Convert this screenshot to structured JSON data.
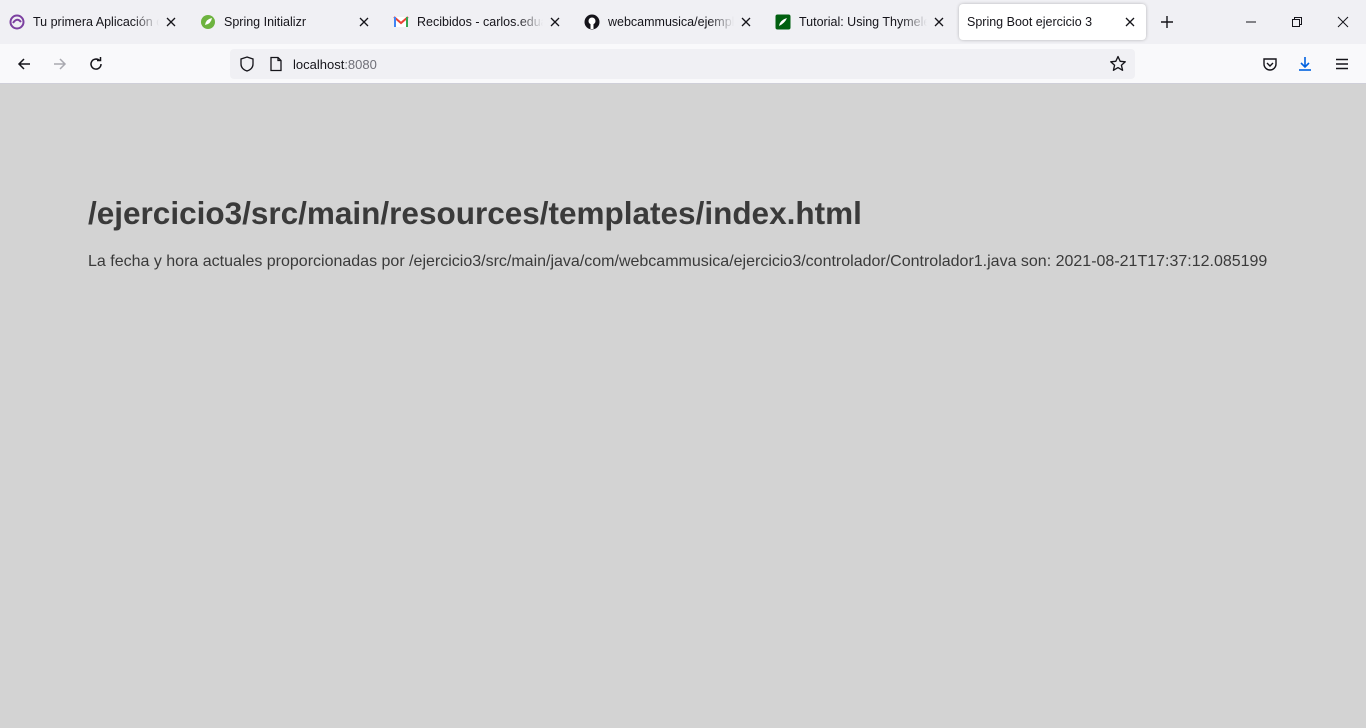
{
  "tabs": [
    {
      "title": "Tu primera Aplicación con",
      "favicon": "purple-swirl-icon",
      "active": false
    },
    {
      "title": "Spring Initializr",
      "favicon": "spring-leaf-icon",
      "active": false
    },
    {
      "title": "Recibidos - carlos.eduardo",
      "favicon": "gmail-icon",
      "active": false
    },
    {
      "title": "webcammusica/ejemplo-",
      "favicon": "github-icon",
      "active": false
    },
    {
      "title": "Tutorial: Using Thymeleaf",
      "favicon": "thymeleaf-icon",
      "active": false
    },
    {
      "title": "Spring Boot ejercicio 3",
      "favicon": "none",
      "active": true
    }
  ],
  "address": {
    "host": "localhost",
    "port": ":8080"
  },
  "toolbar_icons": [
    "back-icon",
    "forward-icon",
    "reload-icon",
    "shield-icon",
    "page-icon",
    "bookmark-star-icon",
    "pocket-icon",
    "download-icon",
    "menu-icon"
  ],
  "window_controls": [
    "minimize-icon",
    "restore-icon",
    "close-icon"
  ],
  "page": {
    "heading": "/ejercicio3/src/main/resources/templates/index.html",
    "paragraph": "La fecha y hora actuales proporcionadas por /ejercicio3/src/main/java/com/webcammusica/ejercicio3/controlador/Controlador1.java son: 2021-08-21T17:37:12.085199"
  },
  "colors": {
    "page_background": "#d3d3d3",
    "text": "#3a3a3a",
    "download_accent": "#0061e0"
  }
}
